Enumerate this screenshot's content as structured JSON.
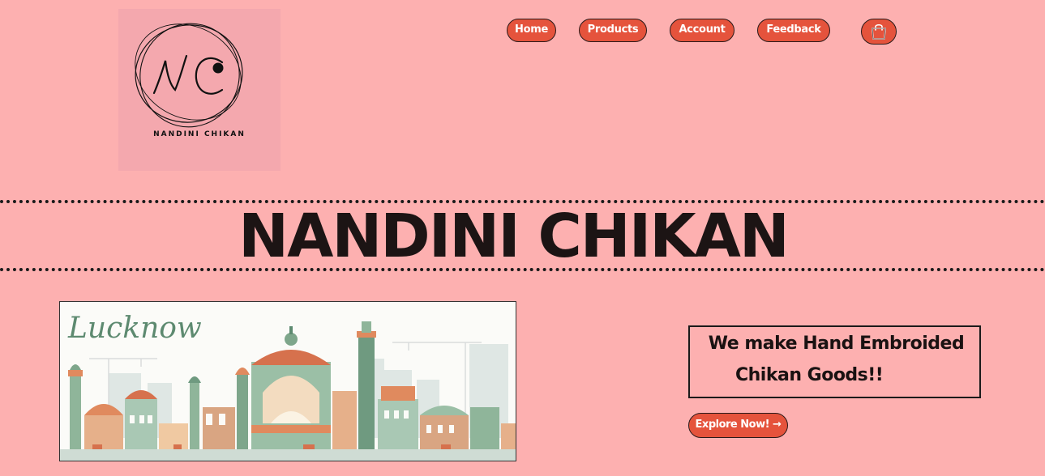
{
  "brand": {
    "logo_monogram": "NC",
    "logo_text": "NANDINI CHIKAN"
  },
  "nav": {
    "items": [
      {
        "label": "Home"
      },
      {
        "label": "Products"
      },
      {
        "label": "Account"
      },
      {
        "label": "Feedback"
      }
    ],
    "cart_icon": "shopping-bag-icon"
  },
  "hero": {
    "title": "NANDINI CHIKAN"
  },
  "banner": {
    "script_text": "Lucknow"
  },
  "tagline": {
    "line1": "We make Hand Embroided",
    "line2": "Chikan Goods!!"
  },
  "cta": {
    "label": "Explore Now! →"
  },
  "colors": {
    "page_bg": "#fdb0b0",
    "logo_bg": "#f4a8ae",
    "button_bg": "#e5533c",
    "text_dark": "#1c1414",
    "skyline_green": "#8fb59a",
    "skyline_orange": "#e08a5e"
  }
}
